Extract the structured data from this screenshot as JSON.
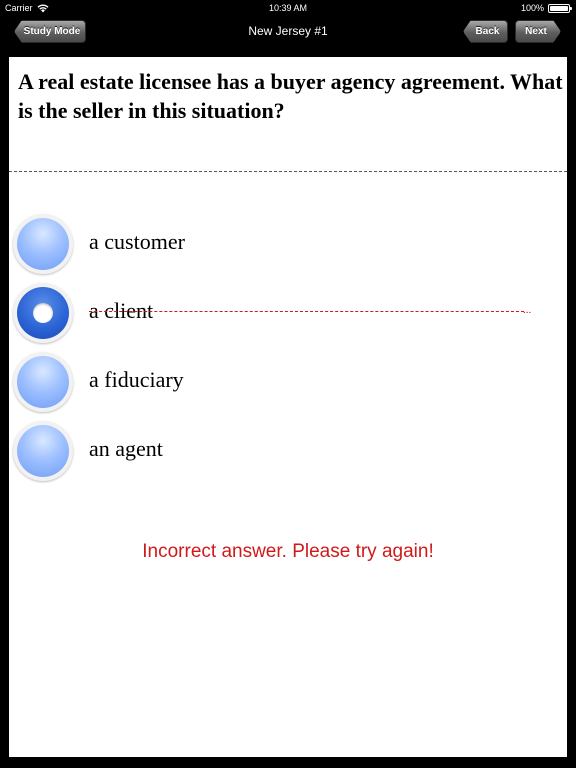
{
  "status_bar": {
    "carrier": "Carrier",
    "time": "10:39 AM",
    "battery": "100%",
    "battery_level": 1.0
  },
  "nav": {
    "title": "New Jersey #1",
    "study_mode_label": "Study Mode",
    "back_label": "Back",
    "next_label": "Next"
  },
  "question": {
    "text": "A real estate licensee has a buyer agency agreement. What is the seller in this situation?"
  },
  "options": [
    {
      "label": "a customer",
      "selected": false
    },
    {
      "label": "a client",
      "selected": true,
      "struck_out": true
    },
    {
      "label": "a fiduciary",
      "selected": false
    },
    {
      "label": "an agent",
      "selected": false
    }
  ],
  "feedback": {
    "text": "Incorrect answer. Please try again!",
    "color": "#d01a1a"
  },
  "colors": {
    "background": "#000000",
    "content_background": "#ffffff",
    "radio_unselected": "#9ec0ff",
    "radio_selected": "#2c64d6"
  },
  "icons": {
    "wifi": "wifi-icon",
    "battery": "battery-icon",
    "radio_selected_dot": "radio-dot-icon"
  }
}
